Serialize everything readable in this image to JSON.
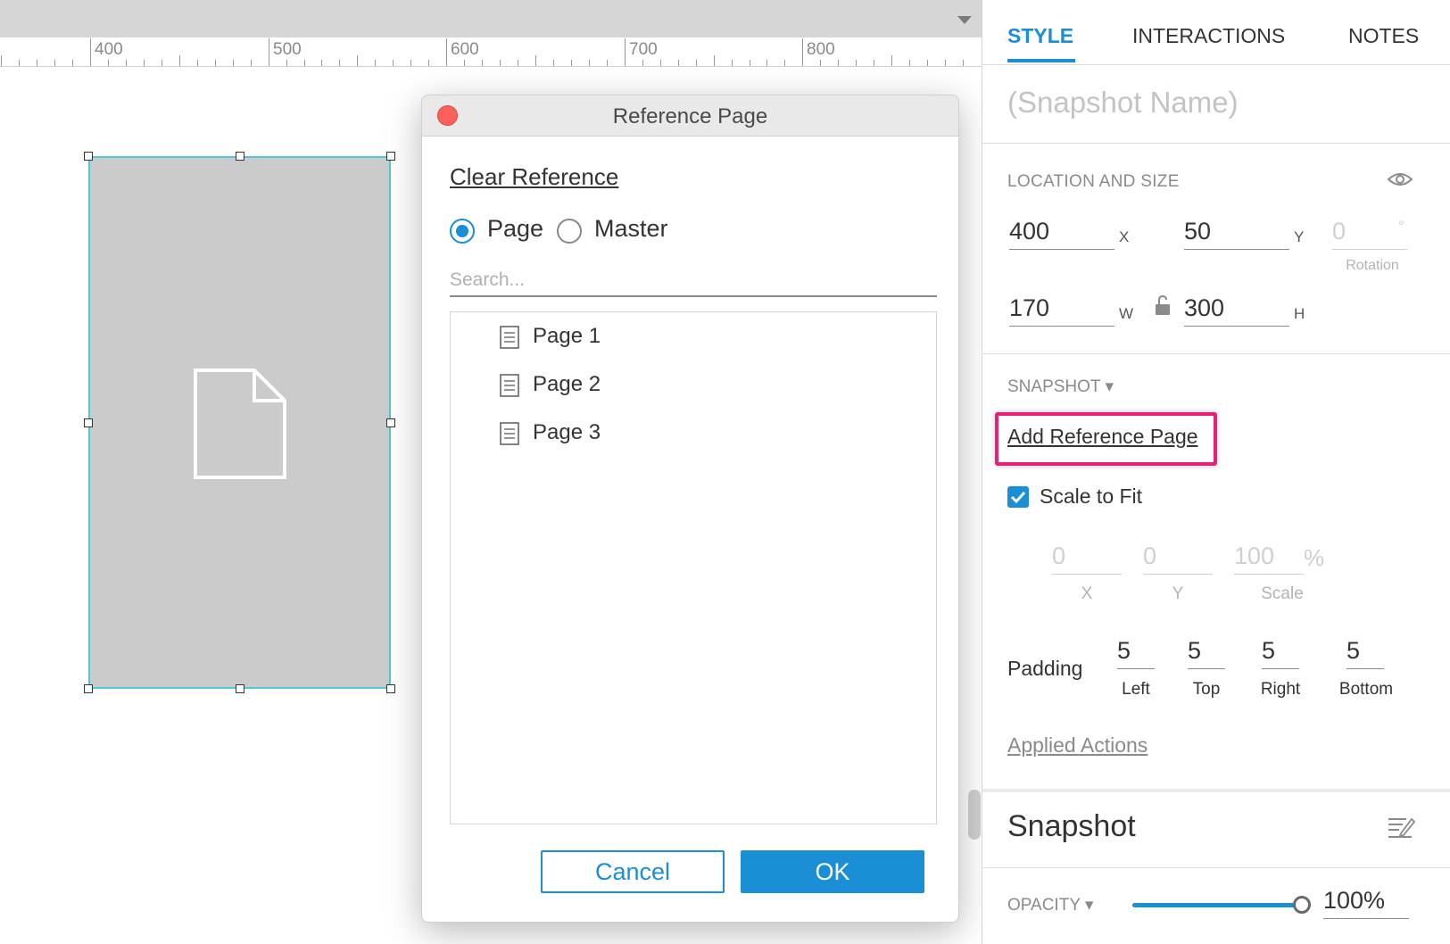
{
  "ruler": {
    "labels": [
      "400",
      "500",
      "600",
      "700",
      "800"
    ]
  },
  "dialog": {
    "title": "Reference Page",
    "clear_reference": "Clear Reference",
    "radio_options": [
      {
        "label": "Page",
        "checked": true
      },
      {
        "label": "Master",
        "checked": false
      }
    ],
    "search_placeholder": "Search...",
    "pages": [
      "Page 1",
      "Page 2",
      "Page 3"
    ],
    "cancel_label": "Cancel",
    "ok_label": "OK"
  },
  "panel": {
    "tabs": [
      "STYLE",
      "INTERACTIONS",
      "NOTES"
    ],
    "active_tab": "STYLE",
    "snapshot_name_placeholder": "(Snapshot Name)",
    "location_and_size": {
      "label": "LOCATION AND SIZE",
      "x": "400",
      "x_label": "X",
      "y": "50",
      "y_label": "Y",
      "rotation": "0",
      "rotation_unit": "°",
      "rotation_label": "Rotation",
      "w": "170",
      "w_label": "W",
      "h": "300",
      "h_label": "H"
    },
    "snapshot": {
      "label": "SNAPSHOT ▾",
      "add_reference_page": "Add Reference Page",
      "scale_to_fit": "Scale to Fit",
      "scale_to_fit_checked": true,
      "offset_x": "0",
      "offset_x_label": "X",
      "offset_y": "0",
      "offset_y_label": "Y",
      "scale": "100",
      "scale_unit": "%",
      "scale_label": "Scale",
      "padding_label": "Padding",
      "padding": [
        {
          "value": "5",
          "label": "Left"
        },
        {
          "value": "5",
          "label": "Top"
        },
        {
          "value": "5",
          "label": "Right"
        },
        {
          "value": "5",
          "label": "Bottom"
        }
      ],
      "applied_actions": "Applied Actions"
    },
    "style_section": {
      "heading": "Snapshot",
      "opacity_label": "OPACITY ▾",
      "opacity_value": "100%"
    }
  },
  "colors": {
    "accent": "#1a8fd6",
    "selection": "#4fc9d4",
    "highlight": "#e8207a",
    "close_button": "#fc605b",
    "widget_fill": "#cbcbcb"
  },
  "icons": [
    "dropdown-arrow-icon",
    "document-icon",
    "close-icon",
    "page-icon",
    "eye-icon",
    "lock-icon",
    "checkmark-icon",
    "edit-notes-icon"
  ]
}
